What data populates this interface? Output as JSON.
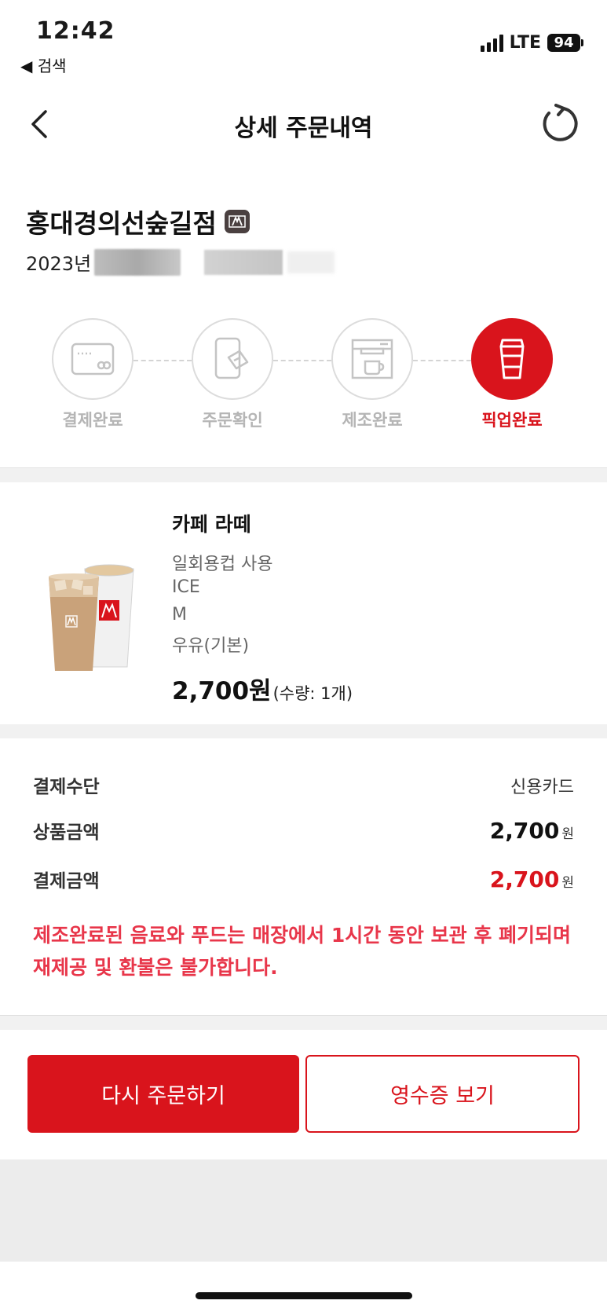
{
  "status_bar": {
    "time": "12:42",
    "back_app": "◀ 검색",
    "network": "LTE",
    "battery": "94"
  },
  "header": {
    "title": "상세 주문내역"
  },
  "store": {
    "name": "홍대경의선숲길점",
    "date_prefix": "2023년"
  },
  "steps": [
    {
      "label": "결제완료",
      "icon": "card-icon",
      "active": false
    },
    {
      "label": "주문확인",
      "icon": "phone-order-icon",
      "active": false
    },
    {
      "label": "제조완료",
      "icon": "coffee-machine-icon",
      "active": false
    },
    {
      "label": "픽업완료",
      "icon": "cup-icon",
      "active": true
    }
  ],
  "item": {
    "name": "카페 라떼",
    "options": [
      "일회용컵 사용",
      "ICE",
      "M",
      "우유(기본)"
    ],
    "price": "2,700원",
    "quantity": "(수량: 1개)"
  },
  "payment": {
    "method_label": "결제수단",
    "method_value": "신용카드",
    "product_label": "상품금액",
    "product_amount": "2,700",
    "product_unit": "원",
    "total_label": "결제금액",
    "total_amount": "2,700",
    "total_unit": "원",
    "notice": "제조완료된 음료와 푸드는 매장에서 1시간 동안 보관 후 폐기되며 재제공 및 환불은 불가합니다."
  },
  "actions": {
    "reorder": "다시 주문하기",
    "receipt": "영수증 보기"
  },
  "colors": {
    "accent": "#d9141c",
    "notice": "#e8364a",
    "inactive": "#b5b5b5"
  }
}
